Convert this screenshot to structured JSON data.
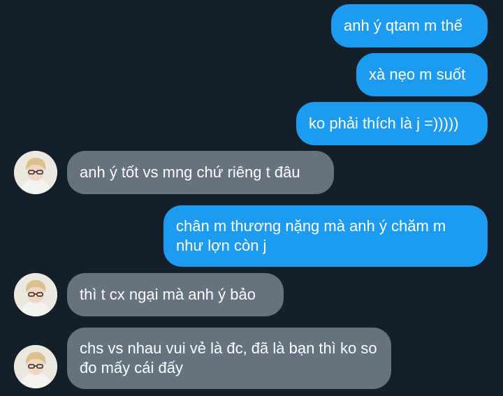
{
  "colors": {
    "background": "#151f2a",
    "sent_bubble": "#1d9bf0",
    "received_bubble": "#66737f",
    "text": "#ffffff"
  },
  "messages": [
    {
      "direction": "sent",
      "text": "anh ý qtam m thế"
    },
    {
      "direction": "sent",
      "text": "xà nẹo m suốt"
    },
    {
      "direction": "sent",
      "text": "ko phải thích là j =)))))"
    },
    {
      "direction": "received",
      "text": "anh ý tốt vs mng chứ riêng t đâu",
      "avatar_icon": "user-avatar"
    },
    {
      "direction": "sent",
      "text": "chân m thương nặng mà anh ý chăm m như lợn còn j"
    },
    {
      "direction": "received",
      "text": "thì t cx ngại mà anh ý bảo",
      "avatar_icon": "user-avatar"
    },
    {
      "direction": "received",
      "text": "chs vs nhau vui vẻ là đc, đã là bạn thì ko so đo mấy cái đấy",
      "avatar_icon": "user-avatar"
    }
  ]
}
